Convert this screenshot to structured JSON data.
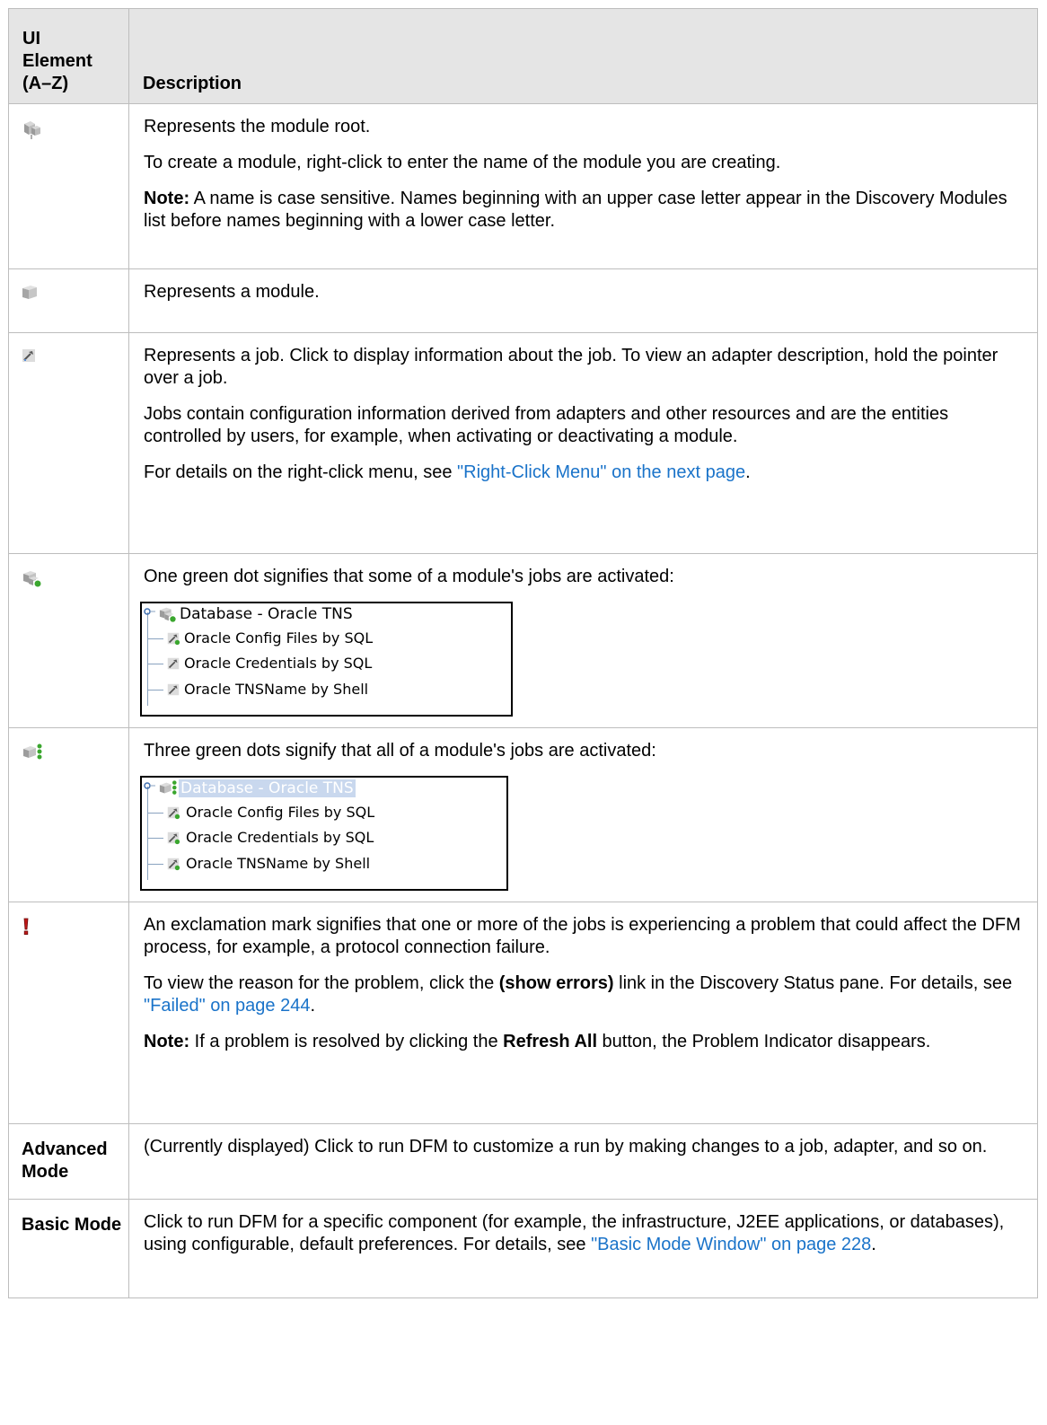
{
  "table": {
    "headers": {
      "element": "UI Element (A–Z)",
      "description": "Description"
    },
    "rows": [
      {
        "icon": "module-root-icon",
        "paragraphs": [
          {
            "text": "Represents the module root."
          },
          {
            "text": "To create a module, right-click to enter the name of the module you are creating."
          },
          {
            "bold": "Note:",
            "text": " A name is case sensitive. Names beginning with an upper case letter appear in the Discovery Modules list before names beginning with a lower case letter."
          }
        ]
      },
      {
        "icon": "module-icon",
        "paragraphs": [
          {
            "text": "Represents a module."
          }
        ]
      },
      {
        "icon": "job-icon",
        "paragraphs": [
          {
            "text": "Represents a job. Click to display information about the job. To view an adapter description, hold the pointer over a job."
          },
          {
            "text": "Jobs contain configuration information derived from adapters and other resources and are the entities controlled by users, for example, when activating or deactivating a module."
          },
          {
            "pre": "For details on the right-click menu, see ",
            "link": "\"Right-Click Menu\" on the next page",
            "post": "."
          }
        ]
      },
      {
        "icon": "module-partially-active-icon",
        "paragraphs": [
          {
            "text": "One green dot signifies that some of a module's jobs are activated:"
          }
        ],
        "tree": {
          "root": "Database - Oracle TNS",
          "children": [
            "Oracle Config Files by SQL",
            "Oracle Credentials by SQL",
            "Oracle TNSName by Shell"
          ]
        }
      },
      {
        "icon": "module-fully-active-icon",
        "paragraphs": [
          {
            "text": "Three green dots signify that all of a module's jobs are activated:"
          }
        ],
        "tree": {
          "root": "Database - Oracle TNS",
          "children": [
            "Oracle Config Files by SQL",
            "Oracle Credentials by SQL",
            "Oracle TNSName by Shell"
          ]
        }
      },
      {
        "icon": "problem-indicator-icon",
        "paragraphs": [
          {
            "text": "An exclamation mark signifies that one or more of the jobs is experiencing a problem that could affect the DFM process, for example, a protocol connection failure."
          },
          {
            "pre": "To view the reason for the problem, click the ",
            "bold": "(show errors)",
            "mid": " link in the Discovery Status pane. For details, see ",
            "link": "\"Failed\" on page 244",
            "post": "."
          },
          {
            "bold": "Note:",
            "pre": " If a problem is resolved by clicking the ",
            "bold2": "Refresh All",
            "post": " button, the Problem Indicator disappears."
          }
        ]
      },
      {
        "label": "Advanced Mode",
        "paragraphs": [
          {
            "text": "(Currently displayed) Click to run DFM to customize a run by making changes to a job, adapter, and so on."
          }
        ]
      },
      {
        "label": "Basic Mode",
        "paragraphs": [
          {
            "pre": "Click to run DFM for a specific component (for example, the infrastructure, J2EE applications, or databases), using configurable, default preferences. For details, see ",
            "link": "\"Basic Mode Window\" on page 228",
            "post": "."
          }
        ]
      }
    ]
  },
  "colors": {
    "link": "#1a73c9",
    "header_bg": "#e5e5e5",
    "border": "#bdbdbd",
    "active_dot": "#3aa62e"
  }
}
